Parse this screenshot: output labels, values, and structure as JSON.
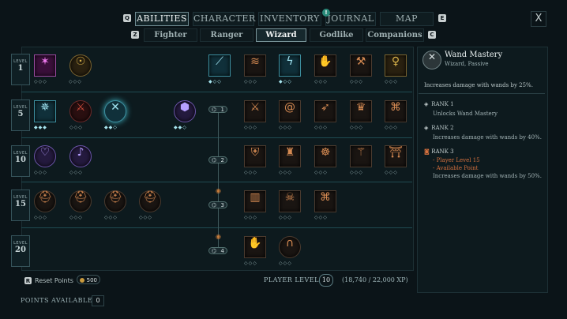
{
  "nav": {
    "left_key": "Q",
    "right_key": "E",
    "tabs": [
      "ABILITIES",
      "CHARACTER",
      "INVENTORY",
      "JOURNAL",
      "MAP"
    ],
    "active_tab": "ABILITIES",
    "journal_badge": "!",
    "close": "X"
  },
  "subnav": {
    "left_key": "Z",
    "right_key": "C",
    "tabs": [
      "Fighter",
      "Ranger",
      "Wizard",
      "Godlike",
      "Companions"
    ],
    "active_tab": "Wizard"
  },
  "levels": [
    {
      "label": "LEVEL",
      "value": "1"
    },
    {
      "label": "LEVEL",
      "value": "5"
    },
    {
      "label": "LEVEL",
      "value": "10"
    },
    {
      "label": "LEVEL",
      "value": "15"
    },
    {
      "label": "LEVEL",
      "value": "20"
    }
  ],
  "tier_nodes": [
    "1",
    "2",
    "3",
    "4"
  ],
  "pips": "◇◇◇",
  "pips_lit": "◆◆◆",
  "pips_mid": "◆◇◇",
  "pips_two": "◆◆◇",
  "bottom": {
    "reset_key": "R",
    "reset_label": "Reset Points",
    "reset_cost": "500",
    "player_level_label": "PLAYER LEVEL",
    "player_level": "10",
    "xp": "(18,740 / 22,000 XP)",
    "points_label": "POINTS AVAILABLE",
    "points": "0"
  },
  "detail": {
    "title": "Wand Mastery",
    "subtitle": "Wizard, Passive",
    "description": "Increases damage with wands by 25%.",
    "ranks": [
      {
        "label": "RANK 1",
        "lines": [
          "Unlocks Wand Mastery"
        ]
      },
      {
        "label": "RANK 2",
        "lines": [
          "Increases damage with wands by 40%."
        ]
      },
      {
        "label": "RANK 3",
        "req": [
          "- Player Level 15",
          "- Available Point"
        ],
        "lines": [
          "Increases damage with wands by 50%."
        ]
      }
    ]
  }
}
